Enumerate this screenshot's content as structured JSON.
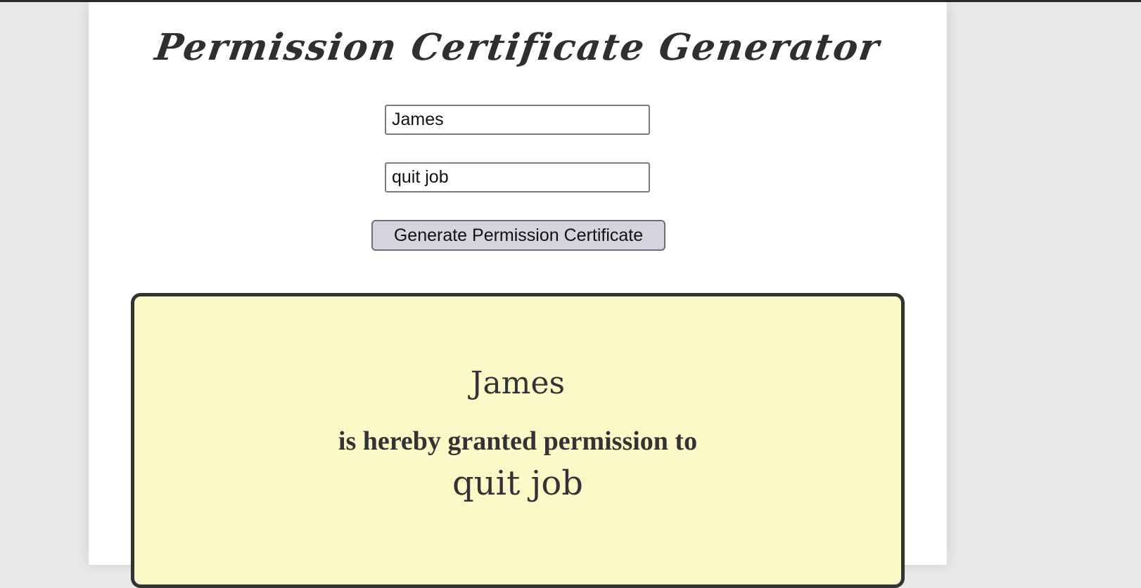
{
  "header": {
    "title": "Permission Certificate Generator"
  },
  "form": {
    "name_value": "James",
    "action_value": "quit job",
    "generate_label": "Generate Permission Certificate"
  },
  "certificate": {
    "name": "James",
    "granted_text": "is hereby granted permission to",
    "action": "quit job"
  },
  "colors": {
    "certificate_background": "#fdf8c8",
    "certificate_border": "#333333",
    "button_background": "#d4d4dc",
    "page_background": "#e8e8e8"
  }
}
